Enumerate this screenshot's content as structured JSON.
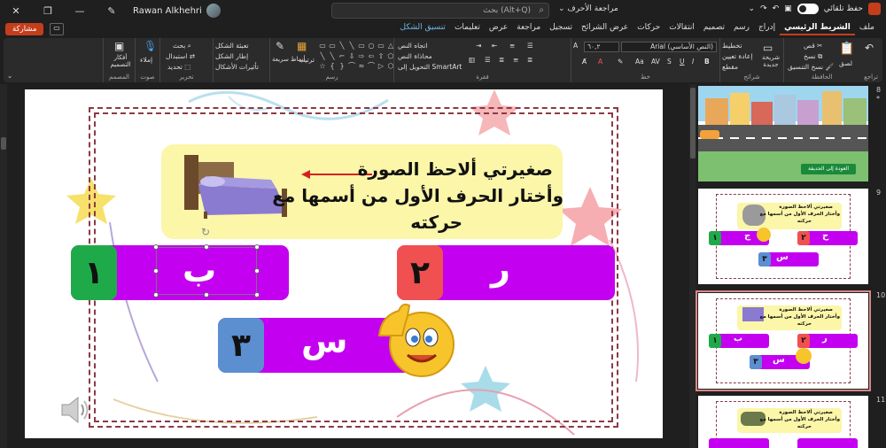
{
  "window": {
    "user_name": "Rawan Alkhehri",
    "search_placeholder": "بحث (Alt+Q)",
    "doc_title": "مراجعة الأحرف",
    "autosave_label": "حفظ تلقائي",
    "colors": {
      "accent": "#c43e1c",
      "background": "#1f1f1f",
      "ribbon": "#2b2b2b"
    }
  },
  "menubar": {
    "share_label": "مشاركة",
    "tabs": [
      {
        "label": "ملف"
      },
      {
        "label": "الشريط الرئيسي",
        "active": true
      },
      {
        "label": "إدراج"
      },
      {
        "label": "رسم"
      },
      {
        "label": "تصميم"
      },
      {
        "label": "انتقالات"
      },
      {
        "label": "حركات"
      },
      {
        "label": "عرض الشرائح"
      },
      {
        "label": "تسجيل"
      },
      {
        "label": "مراجعة"
      },
      {
        "label": "عرض"
      },
      {
        "label": "تعليمات"
      },
      {
        "label": "تنسيق الشكل",
        "contextual": true
      }
    ]
  },
  "ribbon": {
    "undo_label": "تراجع",
    "clipboard": {
      "label": "الحافظة",
      "paste": "لصق",
      "cut": "قص",
      "copy": "نسخ",
      "format_painter": "نسخ التنسيق"
    },
    "slides": {
      "label": "شرائح",
      "new_slide": "شريحة جديدة",
      "layout": "تخطيط",
      "reset": "إعادة تعيين",
      "section": "مقطع"
    },
    "font": {
      "label": "خط",
      "font_name": "Arial (النص الأساسي)",
      "font_size": "٦٠,٢"
    },
    "paragraph": {
      "label": "فقرة",
      "text_direction": "اتجاه النص",
      "align_text": "محاذاة النص",
      "smartart": "التحويل إلى SmartArt"
    },
    "drawing": {
      "label": "رسم",
      "arrange": "ترتيب",
      "quick_styles": "أنماط سريعة",
      "shape_fill": "تعبئة الشكل",
      "shape_outline": "إطار الشكل",
      "shape_effects": "تأثيرات الأشكال"
    },
    "editing": {
      "label": "تحرير",
      "find": "بحث",
      "replace": "استبدال",
      "select": "تحديد"
    },
    "voice": {
      "label": "صوت",
      "dictate": "إملاء"
    },
    "designer": {
      "label": "المصمم",
      "design_ideas": "أفكار التصميم"
    }
  },
  "slide": {
    "question_line1": "صغيرتي ألاحظ الصورة",
    "question_line2": "وأختار الحرف الأول من أسمها مع",
    "question_line3": "حركته",
    "options": [
      {
        "number": "١",
        "letter": "ب",
        "color": "#1faa4a"
      },
      {
        "number": "٢",
        "letter": "ر",
        "color": "#f05050"
      },
      {
        "number": "٣",
        "letter": "س",
        "color": "#5b8fd0"
      }
    ],
    "picture_icon": "bed-picture",
    "audio_icon": "speaker-icon"
  },
  "thumbnails": [
    {
      "number": "8",
      "star": "*",
      "caption": "العودة إلى الحديقة"
    },
    {
      "number": "9",
      "line1": "صغيرتي ألاحظ الصورة",
      "line2": "وأختار الحرف الأول من أسمها مع",
      "line3": "حركته",
      "letters": [
        "ج",
        "ح",
        "س"
      ],
      "numbers": [
        "١",
        "٢",
        "٣"
      ]
    },
    {
      "number": "10",
      "line1": "صغيرتي ألاحظ الصورة",
      "line2": "وأختار الحرف الأول من أسمها مع",
      "line3": "حركته",
      "letters": [
        "ب",
        "ر",
        "س"
      ],
      "numbers": [
        "١",
        "٢",
        "٣"
      ]
    },
    {
      "number": "11",
      "line1": "صغيرتي ألاحظ الصورة",
      "line2": "وأختار الحرف الأول من أسمها مع",
      "line3": "حركته"
    }
  ]
}
